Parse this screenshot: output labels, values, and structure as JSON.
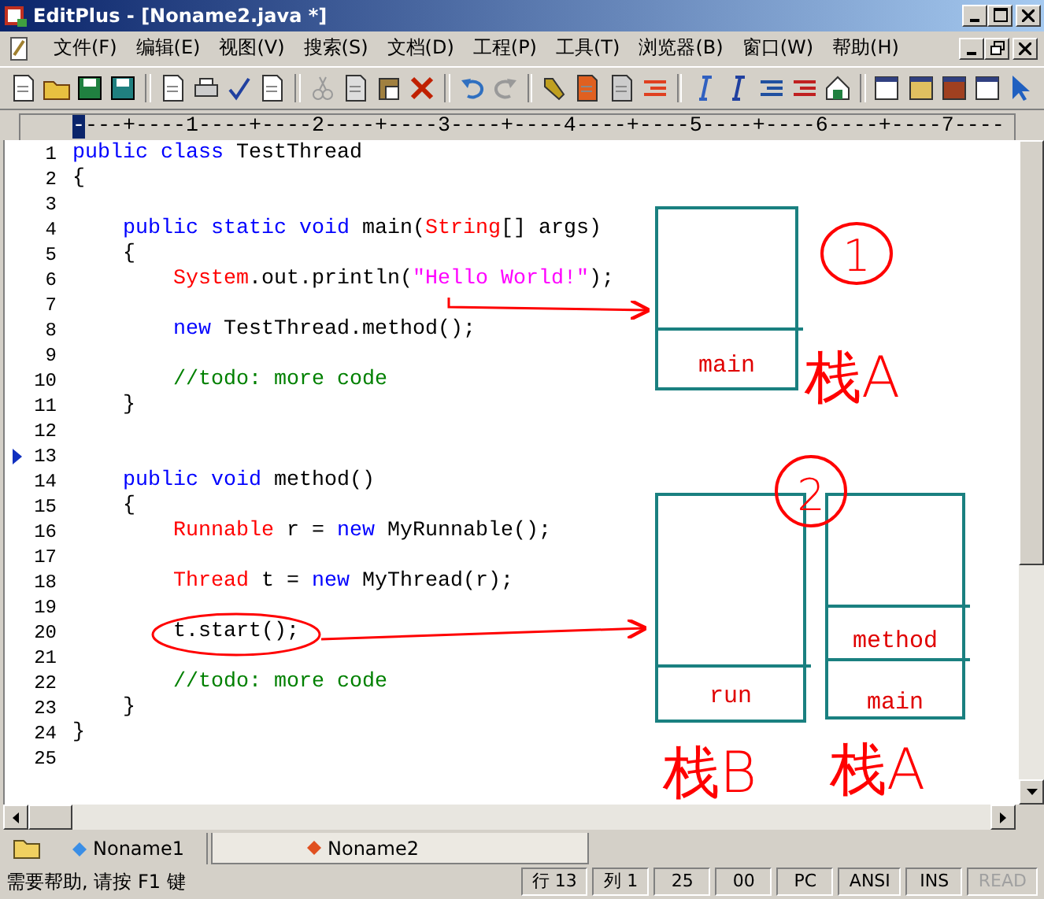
{
  "window": {
    "title": "EditPlus - [Noname2.java *]"
  },
  "menu": [
    {
      "label": "文件(F)"
    },
    {
      "label": "编辑(E)"
    },
    {
      "label": "视图(V)"
    },
    {
      "label": "搜索(S)"
    },
    {
      "label": "文档(D)"
    },
    {
      "label": "工程(P)"
    },
    {
      "label": "工具(T)"
    },
    {
      "label": "浏览器(B)"
    },
    {
      "label": "窗口(W)"
    },
    {
      "label": "帮助(H)"
    }
  ],
  "ruler": {
    "cursor": "-",
    "text": "---+----1----+----2----+----3----+----4----+----5----+----6----+----7----"
  },
  "editor": {
    "lines": [
      {
        "number": "1",
        "current": false,
        "tokens": [
          {
            "kind": "keyword",
            "text": "public class"
          },
          {
            "kind": "plain",
            "text": " TestThread"
          }
        ]
      },
      {
        "number": "2",
        "current": false,
        "tokens": [
          {
            "kind": "plain",
            "text": "{"
          }
        ]
      },
      {
        "number": "3",
        "current": false
      },
      {
        "number": "4",
        "current": false,
        "tokens": [
          {
            "kind": "keyword",
            "text": "    public static void"
          },
          {
            "kind": "plain",
            "text": " main("
          },
          {
            "kind": "type",
            "text": "String"
          },
          {
            "kind": "plain",
            "text": "[] args)"
          }
        ]
      },
      {
        "number": "5",
        "current": false,
        "tokens": [
          {
            "kind": "plain",
            "text": "    {"
          }
        ]
      },
      {
        "number": "6",
        "current": false,
        "tokens": [
          {
            "kind": "type",
            "text": "        System"
          },
          {
            "kind": "plain",
            "text": ".out.println("
          },
          {
            "kind": "string",
            "text": "\"Hello World!\""
          },
          {
            "kind": "plain",
            "text": ");"
          }
        ]
      },
      {
        "number": "7",
        "current": false
      },
      {
        "number": "8",
        "current": false,
        "tokens": [
          {
            "kind": "keyword",
            "text": "        new"
          },
          {
            "kind": "plain",
            "text": " TestThread.method();"
          }
        ]
      },
      {
        "number": "9",
        "current": false
      },
      {
        "number": "10",
        "current": false,
        "tokens": [
          {
            "kind": "comment",
            "text": "        //todo: more code"
          }
        ]
      },
      {
        "number": "11",
        "current": false,
        "tokens": [
          {
            "kind": "plain",
            "text": "    }"
          }
        ]
      },
      {
        "number": "12",
        "current": false
      },
      {
        "number": "13",
        "current": true
      },
      {
        "number": "14",
        "current": false,
        "tokens": [
          {
            "kind": "keyword",
            "text": "    public void"
          },
          {
            "kind": "plain",
            "text": " method()"
          }
        ]
      },
      {
        "number": "15",
        "current": false,
        "tokens": [
          {
            "kind": "plain",
            "text": "    {"
          }
        ]
      },
      {
        "number": "16",
        "current": false,
        "tokens": [
          {
            "kind": "type",
            "text": "        Runnable"
          },
          {
            "kind": "plain",
            "text": " r = "
          },
          {
            "kind": "keyword",
            "text": "new"
          },
          {
            "kind": "plain",
            "text": " MyRunnable();"
          }
        ]
      },
      {
        "number": "17",
        "current": false
      },
      {
        "number": "18",
        "current": false,
        "tokens": [
          {
            "kind": "type",
            "text": "        Thread"
          },
          {
            "kind": "plain",
            "text": " t = "
          },
          {
            "kind": "keyword",
            "text": "new"
          },
          {
            "kind": "plain",
            "text": " MyThread(r);"
          }
        ]
      },
      {
        "number": "19",
        "current": false
      },
      {
        "number": "20",
        "current": false,
        "tokens": [
          {
            "kind": "plain",
            "text": "        t.start();"
          }
        ]
      },
      {
        "number": "21",
        "current": false
      },
      {
        "number": "22",
        "current": false,
        "tokens": [
          {
            "kind": "comment",
            "text": "        //todo: more code"
          }
        ]
      },
      {
        "number": "23",
        "current": false,
        "tokens": [
          {
            "kind": "plain",
            "text": "    }"
          }
        ]
      },
      {
        "number": "24",
        "current": false,
        "tokens": [
          {
            "kind": "plain",
            "text": "}"
          }
        ]
      },
      {
        "number": "25",
        "current": false
      }
    ]
  },
  "annotations": {
    "stacks": [
      {
        "frames": [
          "main"
        ]
      },
      {
        "frames": [
          "run"
        ]
      },
      {
        "frames": [
          "method",
          "main"
        ]
      }
    ],
    "marks": [
      "1",
      "2"
    ],
    "stack_labels": [
      "栈A",
      "栈B",
      "栈A"
    ]
  },
  "tabs": [
    {
      "label": "Noname1",
      "selected": false,
      "color": "#3a8ee6"
    },
    {
      "label": "Noname2",
      "selected": true,
      "color": "#e05020"
    }
  ],
  "status_bar": {
    "message": "需要帮助, 请按 F1 键",
    "panes": [
      {
        "text": "行 13",
        "disabled": false
      },
      {
        "text": "列 1",
        "disabled": false
      },
      {
        "text": "25",
        "disabled": false
      },
      {
        "text": "00",
        "disabled": false
      },
      {
        "text": "PC",
        "disabled": false
      },
      {
        "text": "ANSI",
        "disabled": false
      },
      {
        "text": "INS",
        "disabled": false
      },
      {
        "text": "READ",
        "disabled": true
      }
    ]
  }
}
